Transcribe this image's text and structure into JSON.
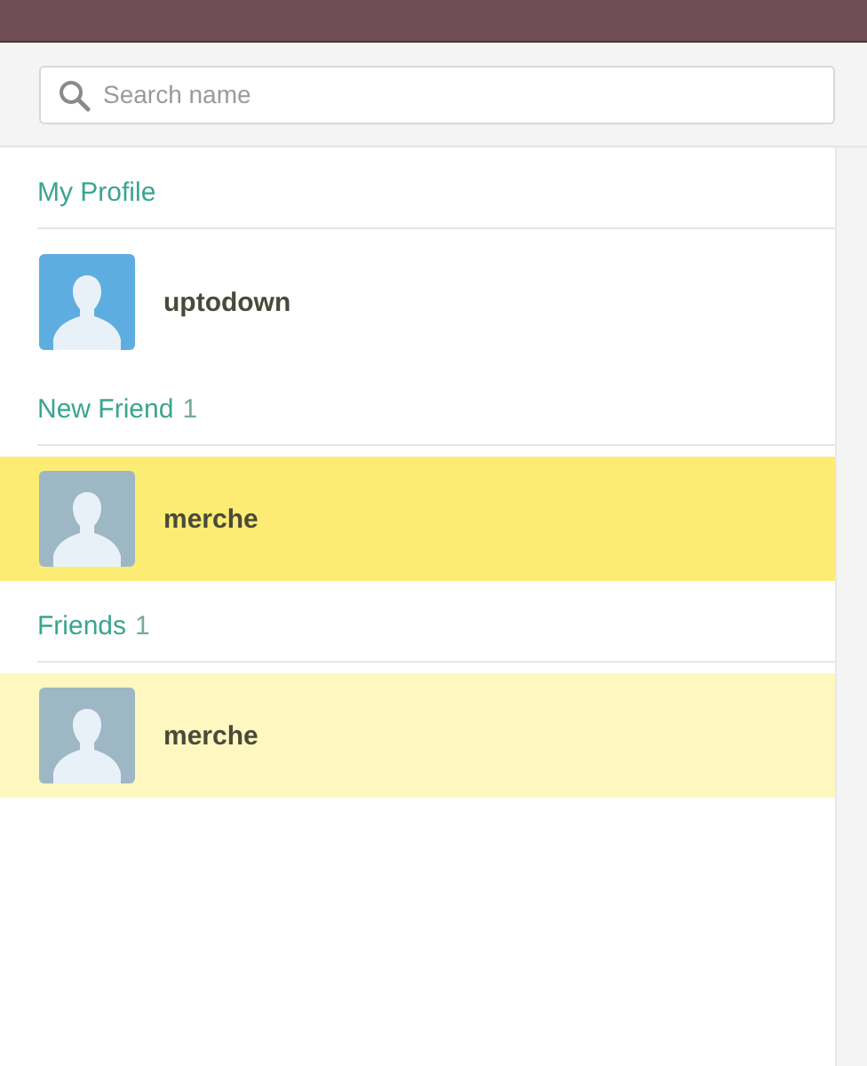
{
  "search": {
    "placeholder": "Search name"
  },
  "sections": [
    {
      "title": "My Profile",
      "people": [
        {
          "name": "uptodown",
          "color": "#5eade0",
          "selected": false,
          "hovered": false
        }
      ]
    },
    {
      "title": "New Friend",
      "count": "1",
      "people": [
        {
          "name": "merche",
          "color": "#9db8c4",
          "selected": true,
          "hovered": false
        }
      ]
    },
    {
      "title": "Friends",
      "count": "1",
      "people": [
        {
          "name": "merche",
          "color": "#9db8c4",
          "selected": false,
          "hovered": true
        }
      ]
    }
  ]
}
